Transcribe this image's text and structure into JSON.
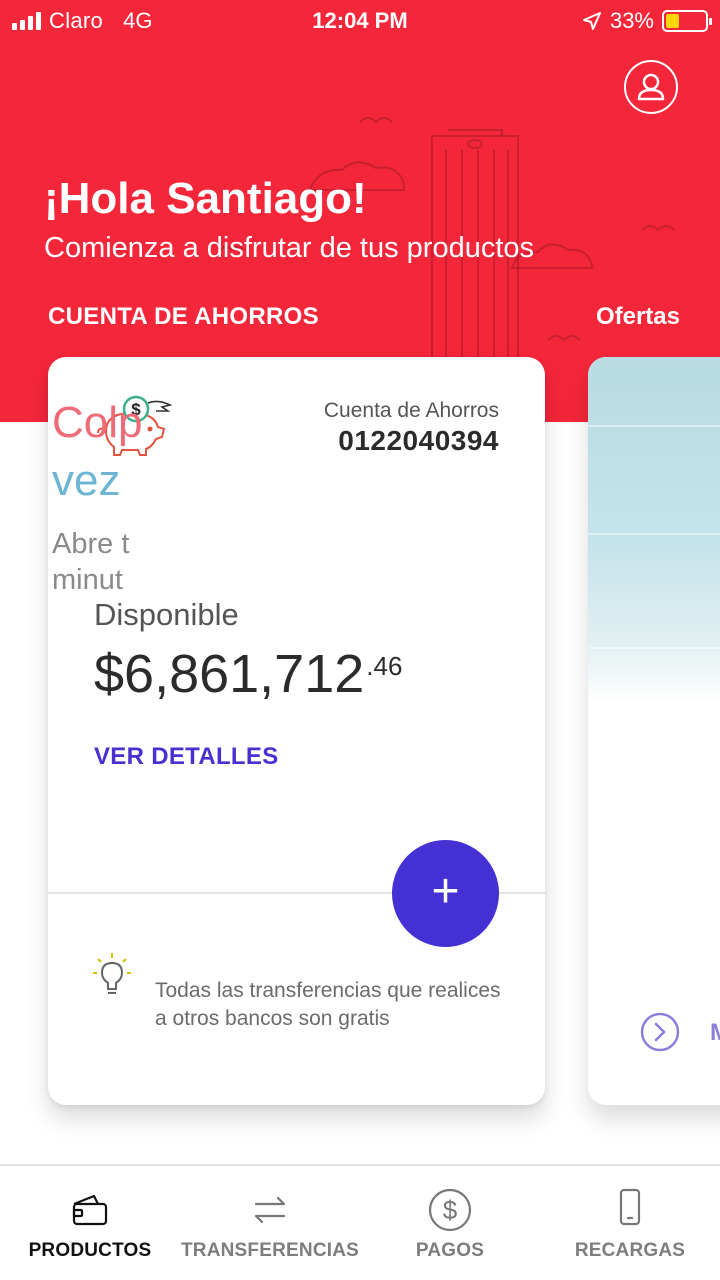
{
  "status_bar": {
    "carrier": "Claro",
    "network": "4G",
    "time": "12:04 PM",
    "battery": "33%",
    "battery_level": 0.33
  },
  "header": {
    "greeting": "¡Hola Santiago!",
    "subtitle": "Comienza a disfrutar de tus productos",
    "section_label": "CUENTA DE AHORROS",
    "offers_label": "Ofertas"
  },
  "account_card": {
    "account_type": "Cuenta de Ahorros",
    "account_number": "0122040394",
    "available_label": "Disponible",
    "balance_main": "$6,861,712",
    "balance_cents": ".46",
    "details_link": "VER DETALLES",
    "add_symbol": "+",
    "tip": "Todas las transferencias que realices a otros bancos son gratis"
  },
  "promo_card": {
    "title_line1": "Colp",
    "title_line2": "vez",
    "text_line1": "Abre t",
    "text_line2": "minut",
    "more_label": "M"
  },
  "tab_bar": {
    "tabs": [
      {
        "label": "PRODUCTOS",
        "icon": "wallet-icon",
        "active": true
      },
      {
        "label": "TRANSFERENCIAS",
        "icon": "transfer-arrows-icon",
        "active": false
      },
      {
        "label": "PAGOS",
        "icon": "dollar-circle-icon",
        "active": false
      },
      {
        "label": "RECARGAS",
        "icon": "smartphone-icon",
        "active": false
      }
    ]
  },
  "colors": {
    "brand_red": "#f4263a",
    "accent_purple": "#4530d4",
    "link_purple": "#4a2fd1"
  }
}
